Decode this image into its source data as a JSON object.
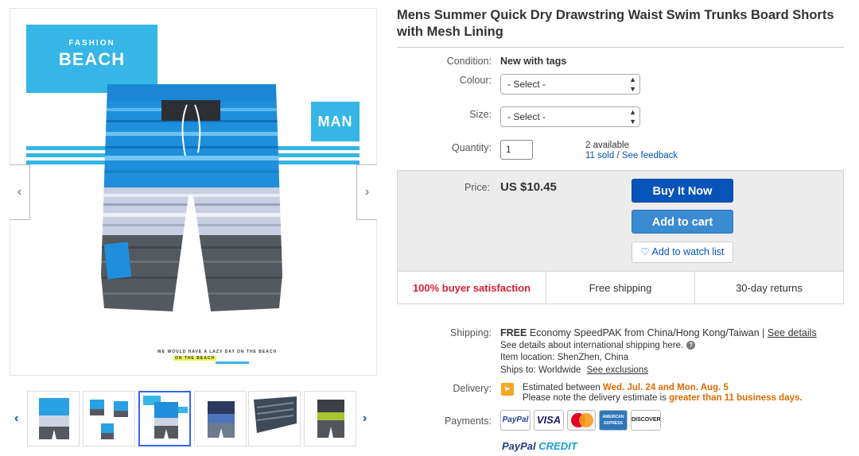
{
  "gallery": {
    "banner_small": "FASHION",
    "banner_big": "BEACH",
    "banner_man": "MAN",
    "tagline_1": "WE WOULD HAVE A LAZY DAY ON THE BEACH",
    "tagline_2": "ON THE BEACH",
    "prev_icon": "‹",
    "next_icon": "›",
    "thumb_prev": "‹",
    "thumb_next": "›",
    "thumbnail_count": 6,
    "selected_thumbnail": 3
  },
  "product": {
    "title": "Mens Summer Quick Dry Drawstring Waist Swim Trunks Board Shorts with Mesh Lining"
  },
  "details": {
    "condition_label": "Condition:",
    "condition_value": "New with tags",
    "colour_label": "Colour:",
    "colour_selected": "- Select -",
    "size_label": "Size:",
    "size_selected": "- Select -",
    "quantity_label": "Quantity:",
    "quantity_value": "1",
    "available": "2 available",
    "sold": "11 sold",
    "separator": "/",
    "feedback": "See feedback"
  },
  "buy_box": {
    "price_label": "Price:",
    "price": "US $10.45",
    "buy_now": "Buy It Now",
    "add_to_cart": "Add to cart",
    "watch_list": "Add to watch list",
    "badge_satisfaction": "100% buyer satisfaction",
    "badge_shipping": "Free shipping",
    "badge_returns": "30-day returns"
  },
  "shipping": {
    "label": "Shipping:",
    "free": "FREE",
    "method": "Economy SpeedPAK from China/Hong Kong/Taiwan |",
    "see_details": "See details",
    "intl_note": "See details about international shipping here.",
    "help": "?",
    "item_location": "Item location:  ShenZhen, China",
    "ships_to": "Ships to:  Worldwide",
    "see_exclusions": "See exclusions"
  },
  "delivery": {
    "label": "Delivery:",
    "icon_glyph": "▸",
    "estimated_prefix": "Estimated between",
    "estimated_dates": "Wed. Jul. 24 and Mon. Aug. 5",
    "note_prefix": "Please note the delivery estimate is",
    "note_emphasis": "greater than 11 business days."
  },
  "payments": {
    "label": "Payments:",
    "logos": [
      "PayPal",
      "VISA",
      "MasterCard",
      "AMERICAN EXPRESS",
      "DISCOVER"
    ],
    "paypal_credit_1": "PayPal",
    "paypal_credit_2": "CREDIT"
  },
  "colors": {
    "brand_blue": "#0654ba",
    "accent_blue": "#35b6e6",
    "cart_blue": "#3a8bd1",
    "satisfaction_red": "#dd1e31",
    "delivery_orange": "#dd6b00"
  }
}
